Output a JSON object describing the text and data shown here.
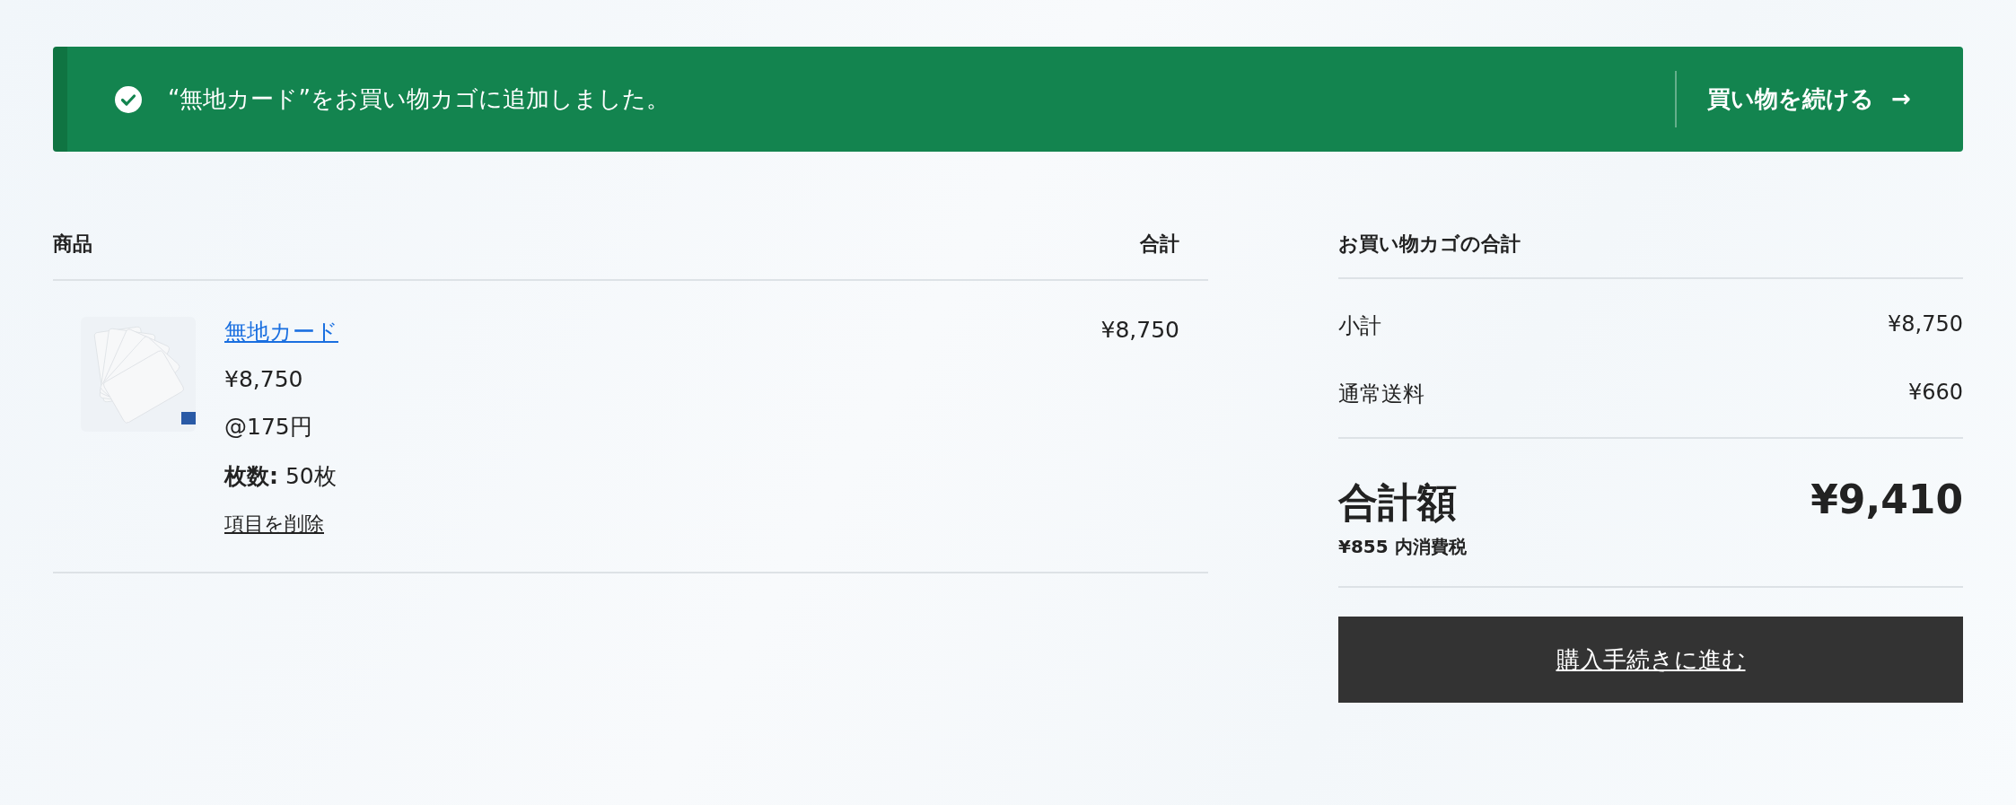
{
  "notice": {
    "message": "“無地カード”をお買い物カゴに追加しました。",
    "action": "買い物を続ける",
    "arrow": "→"
  },
  "cart": {
    "columns": [
      "商品",
      "合計"
    ],
    "items": [
      {
        "name": "無地カード",
        "price": "¥8,750",
        "unit_price": "@175円",
        "detail": "**枚数:** 50枚",
        "remove": "項目を削除",
        "total": "¥8,750"
      }
    ]
  },
  "totals": {
    "title": "お買い物カゴの合計",
    "rows": [
      {
        "label": "小計",
        "value": "¥8,750"
      },
      {
        "label": "通常送料",
        "value": "¥660"
      }
    ],
    "grand": {
      "label": "合計額",
      "value": "¥9,410",
      "tax_note": "¥855 内消費税"
    },
    "checkout": "購入手続きに進む"
  }
}
